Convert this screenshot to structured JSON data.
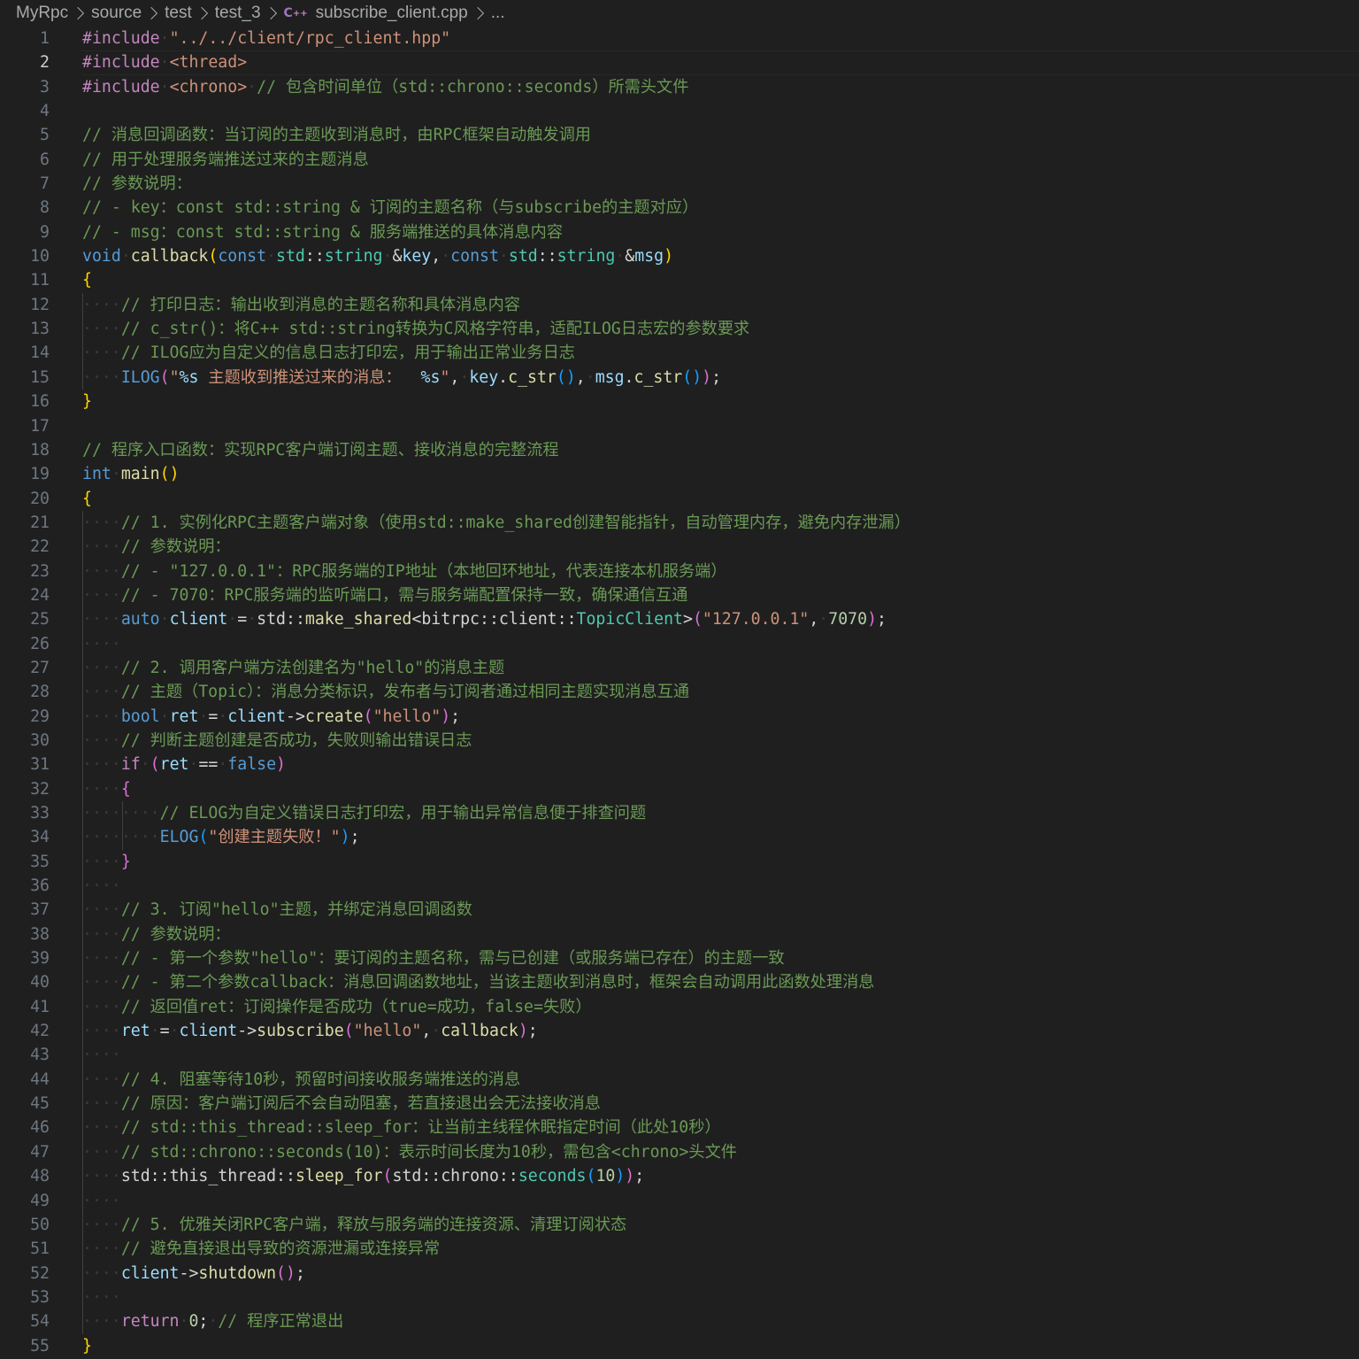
{
  "breadcrumb": {
    "items": [
      "MyRpc",
      "source",
      "test",
      "test_3"
    ],
    "file_icon": "cpp-file-icon",
    "file_icon_text": "C++",
    "file": "subscribe_client.cpp",
    "more": "..."
  },
  "editor": {
    "language": "cpp",
    "current_line": 2,
    "theme_colors": {
      "background": "#1f1f1f",
      "keyword": "#569cd6",
      "control": "#c586c0",
      "string": "#ce9178",
      "function": "#dcdcaa",
      "variable": "#9cdcfe",
      "type": "#4ec9b0",
      "number": "#b5cea8",
      "comment": "#6a9955",
      "line_number": "#6e7681"
    },
    "lines": [
      {
        "n": "1",
        "indent": 0,
        "t": [
          [
            "pp",
            "#include"
          ],
          [
            "ws",
            "·"
          ],
          [
            "str",
            "\"../../client/rpc_client.hpp\""
          ]
        ]
      },
      {
        "n": "2",
        "indent": 0,
        "t": [
          [
            "pp",
            "#include"
          ],
          [
            "ws",
            "·"
          ],
          [
            "str",
            "<thread>"
          ]
        ]
      },
      {
        "n": "3",
        "indent": 0,
        "t": [
          [
            "pp",
            "#include"
          ],
          [
            "ws",
            "·"
          ],
          [
            "str",
            "<chrono>"
          ],
          [
            "ws",
            "·"
          ],
          [
            "cmt",
            "// 包含时间单位（std::chrono::seconds）所需头文件"
          ]
        ]
      },
      {
        "n": "4",
        "indent": 0,
        "t": []
      },
      {
        "n": "5",
        "indent": 0,
        "t": [
          [
            "cmt",
            "// 消息回调函数：当订阅的主题收到消息时，由RPC框架自动触发调用"
          ]
        ]
      },
      {
        "n": "6",
        "indent": 0,
        "t": [
          [
            "cmt",
            "// 用于处理服务端推送过来的主题消息"
          ]
        ]
      },
      {
        "n": "7",
        "indent": 0,
        "t": [
          [
            "cmt",
            "// 参数说明："
          ]
        ]
      },
      {
        "n": "8",
        "indent": 0,
        "t": [
          [
            "cmt",
            "// - key：const std::string & 订阅的主题名称（与subscribe的主题对应）"
          ]
        ]
      },
      {
        "n": "9",
        "indent": 0,
        "t": [
          [
            "cmt",
            "// - msg：const std::string & 服务端推送的具体消息内容"
          ]
        ]
      },
      {
        "n": "10",
        "indent": 0,
        "t": [
          [
            "kw",
            "void"
          ],
          [
            "ws",
            "·"
          ],
          [
            "fn",
            "callback"
          ],
          [
            "b1",
            "("
          ],
          [
            "kw",
            "const"
          ],
          [
            "ws",
            "·"
          ],
          [
            "type",
            "std"
          ],
          [
            "op",
            "::"
          ],
          [
            "type",
            "string"
          ],
          [
            "ws",
            "·"
          ],
          [
            "op",
            "&"
          ],
          [
            "var",
            "key"
          ],
          [
            "op",
            ","
          ],
          [
            "ws",
            "·"
          ],
          [
            "kw",
            "const"
          ],
          [
            "ws",
            "·"
          ],
          [
            "type",
            "std"
          ],
          [
            "op",
            "::"
          ],
          [
            "type",
            "string"
          ],
          [
            "ws",
            "·"
          ],
          [
            "op",
            "&"
          ],
          [
            "var",
            "msg"
          ],
          [
            "b1",
            ")"
          ]
        ]
      },
      {
        "n": "11",
        "indent": 0,
        "t": [
          [
            "b1",
            "{"
          ]
        ]
      },
      {
        "n": "12",
        "indent": 1,
        "t": [
          [
            "cmt",
            "// 打印日志：输出收到消息的主题名称和具体消息内容"
          ]
        ]
      },
      {
        "n": "13",
        "indent": 1,
        "t": [
          [
            "cmt",
            "// c_str()：将C++ std::string转换为C风格字符串，适配ILOG日志宏的参数要求"
          ]
        ]
      },
      {
        "n": "14",
        "indent": 1,
        "t": [
          [
            "cmt",
            "// ILOG应为自定义的信息日志打印宏，用于输出正常业务日志"
          ]
        ]
      },
      {
        "n": "15",
        "indent": 1,
        "t": [
          [
            "mac",
            "ILOG"
          ],
          [
            "b2",
            "("
          ],
          [
            "str",
            "\""
          ],
          [
            "esc",
            "%s"
          ],
          [
            "str",
            " 主题收到推送过来的消息：  "
          ],
          [
            "esc",
            "%s"
          ],
          [
            "str",
            "\""
          ],
          [
            "op",
            ","
          ],
          [
            "ws",
            "·"
          ],
          [
            "var",
            "key"
          ],
          [
            "op",
            "."
          ],
          [
            "fn",
            "c_str"
          ],
          [
            "b3",
            "()"
          ],
          [
            "op",
            ","
          ],
          [
            "ws",
            "·"
          ],
          [
            "var",
            "msg"
          ],
          [
            "op",
            "."
          ],
          [
            "fn",
            "c_str"
          ],
          [
            "b3",
            "()"
          ],
          [
            "b2",
            ")"
          ],
          [
            "op",
            ";"
          ]
        ]
      },
      {
        "n": "16",
        "indent": 0,
        "t": [
          [
            "b1",
            "}"
          ]
        ]
      },
      {
        "n": "17",
        "indent": 0,
        "t": []
      },
      {
        "n": "18",
        "indent": 0,
        "t": [
          [
            "cmt",
            "// 程序入口函数：实现RPC客户端订阅主题、接收消息的完整流程"
          ]
        ]
      },
      {
        "n": "19",
        "indent": 0,
        "t": [
          [
            "kw",
            "int"
          ],
          [
            "ws",
            "·"
          ],
          [
            "fn",
            "main"
          ],
          [
            "b1",
            "()"
          ]
        ]
      },
      {
        "n": "20",
        "indent": 0,
        "t": [
          [
            "b1",
            "{"
          ]
        ]
      },
      {
        "n": "21",
        "indent": 1,
        "t": [
          [
            "cmt",
            "// 1. 实例化RPC主题客户端对象（使用std::make_shared创建智能指针，自动管理内存，避免内存泄漏）"
          ]
        ]
      },
      {
        "n": "22",
        "indent": 1,
        "t": [
          [
            "cmt",
            "// 参数说明："
          ]
        ]
      },
      {
        "n": "23",
        "indent": 1,
        "t": [
          [
            "cmt",
            "// - \"127.0.0.1\"：RPC服务端的IP地址（本地回环地址，代表连接本机服务端）"
          ]
        ]
      },
      {
        "n": "24",
        "indent": 1,
        "t": [
          [
            "cmt",
            "// - 7070：RPC服务端的监听端口，需与服务端配置保持一致，确保通信互通"
          ]
        ]
      },
      {
        "n": "25",
        "indent": 1,
        "t": [
          [
            "kw",
            "auto"
          ],
          [
            "ws",
            "·"
          ],
          [
            "var",
            "client"
          ],
          [
            "ws",
            "·"
          ],
          [
            "op",
            "="
          ],
          [
            "ws",
            "·"
          ],
          [
            "txt",
            "std"
          ],
          [
            "op",
            "::"
          ],
          [
            "fn",
            "make_shared"
          ],
          [
            "op",
            "<"
          ],
          [
            "txt",
            "bitrpc"
          ],
          [
            "op",
            "::"
          ],
          [
            "txt",
            "client"
          ],
          [
            "op",
            "::"
          ],
          [
            "type",
            "TopicClient"
          ],
          [
            "op",
            ">"
          ],
          [
            "b2",
            "("
          ],
          [
            "str",
            "\"127.0.0.1\""
          ],
          [
            "op",
            ","
          ],
          [
            "ws",
            "·"
          ],
          [
            "num",
            "7070"
          ],
          [
            "b2",
            ")"
          ],
          [
            "op",
            ";"
          ]
        ]
      },
      {
        "n": "26",
        "indent": 1,
        "t": []
      },
      {
        "n": "27",
        "indent": 1,
        "t": [
          [
            "cmt",
            "// 2. 调用客户端方法创建名为\"hello\"的消息主题"
          ]
        ]
      },
      {
        "n": "28",
        "indent": 1,
        "t": [
          [
            "cmt",
            "// 主题（Topic）：消息分类标识，发布者与订阅者通过相同主题实现消息互通"
          ]
        ]
      },
      {
        "n": "29",
        "indent": 1,
        "t": [
          [
            "kw",
            "bool"
          ],
          [
            "ws",
            "·"
          ],
          [
            "var",
            "ret"
          ],
          [
            "ws",
            "·"
          ],
          [
            "op",
            "="
          ],
          [
            "ws",
            "·"
          ],
          [
            "var",
            "client"
          ],
          [
            "op",
            "->"
          ],
          [
            "fn",
            "create"
          ],
          [
            "b2",
            "("
          ],
          [
            "str",
            "\"hello\""
          ],
          [
            "b2",
            ")"
          ],
          [
            "op",
            ";"
          ]
        ]
      },
      {
        "n": "30",
        "indent": 1,
        "t": [
          [
            "cmt",
            "// 判断主题创建是否成功，失败则输出错误日志"
          ]
        ]
      },
      {
        "n": "31",
        "indent": 1,
        "t": [
          [
            "ctrl",
            "if"
          ],
          [
            "ws",
            "·"
          ],
          [
            "b2",
            "("
          ],
          [
            "var",
            "ret"
          ],
          [
            "ws",
            "·"
          ],
          [
            "op",
            "=="
          ],
          [
            "ws",
            "·"
          ],
          [
            "kw",
            "false"
          ],
          [
            "b2",
            ")"
          ]
        ]
      },
      {
        "n": "32",
        "indent": 1,
        "t": [
          [
            "b2",
            "{"
          ]
        ]
      },
      {
        "n": "33",
        "indent": 2,
        "t": [
          [
            "cmt",
            "// ELOG为自定义错误日志打印宏，用于输出异常信息便于排查问题"
          ]
        ]
      },
      {
        "n": "34",
        "indent": 2,
        "t": [
          [
            "mac",
            "ELOG"
          ],
          [
            "b3",
            "("
          ],
          [
            "str",
            "\"创建主题失败！\""
          ],
          [
            "b3",
            ")"
          ],
          [
            "op",
            ";"
          ]
        ]
      },
      {
        "n": "35",
        "indent": 1,
        "t": [
          [
            "b2",
            "}"
          ]
        ]
      },
      {
        "n": "36",
        "indent": 1,
        "t": []
      },
      {
        "n": "37",
        "indent": 1,
        "t": [
          [
            "cmt",
            "// 3. 订阅\"hello\"主题，并绑定消息回调函数"
          ]
        ]
      },
      {
        "n": "38",
        "indent": 1,
        "t": [
          [
            "cmt",
            "// 参数说明："
          ]
        ]
      },
      {
        "n": "39",
        "indent": 1,
        "t": [
          [
            "cmt",
            "// - 第一个参数\"hello\"：要订阅的主题名称，需与已创建（或服务端已存在）的主题一致"
          ]
        ]
      },
      {
        "n": "40",
        "indent": 1,
        "t": [
          [
            "cmt",
            "// - 第二个参数callback：消息回调函数地址，当该主题收到消息时，框架会自动调用此函数处理消息"
          ]
        ]
      },
      {
        "n": "41",
        "indent": 1,
        "t": [
          [
            "cmt",
            "// 返回值ret：订阅操作是否成功（true=成功，false=失败）"
          ]
        ]
      },
      {
        "n": "42",
        "indent": 1,
        "t": [
          [
            "var",
            "ret"
          ],
          [
            "ws",
            "·"
          ],
          [
            "op",
            "="
          ],
          [
            "ws",
            "·"
          ],
          [
            "var",
            "client"
          ],
          [
            "op",
            "->"
          ],
          [
            "fn",
            "subscribe"
          ],
          [
            "b2",
            "("
          ],
          [
            "str",
            "\"hello\""
          ],
          [
            "op",
            ","
          ],
          [
            "ws",
            "·"
          ],
          [
            "fn",
            "callback"
          ],
          [
            "b2",
            ")"
          ],
          [
            "op",
            ";"
          ]
        ]
      },
      {
        "n": "43",
        "indent": 1,
        "t": []
      },
      {
        "n": "44",
        "indent": 1,
        "t": [
          [
            "cmt",
            "// 4. 阻塞等待10秒，预留时间接收服务端推送的消息"
          ]
        ]
      },
      {
        "n": "45",
        "indent": 1,
        "t": [
          [
            "cmt",
            "// 原因：客户端订阅后不会自动阻塞，若直接退出会无法接收消息"
          ]
        ]
      },
      {
        "n": "46",
        "indent": 1,
        "t": [
          [
            "cmt",
            "// std::this_thread::sleep_for：让当前主线程休眠指定时间（此处10秒）"
          ]
        ]
      },
      {
        "n": "47",
        "indent": 1,
        "t": [
          [
            "cmt",
            "// std::chrono::seconds(10)：表示时间长度为10秒，需包含<chrono>头文件"
          ]
        ]
      },
      {
        "n": "48",
        "indent": 1,
        "t": [
          [
            "txt",
            "std"
          ],
          [
            "op",
            "::"
          ],
          [
            "txt",
            "this_thread"
          ],
          [
            "op",
            "::"
          ],
          [
            "fn",
            "sleep_for"
          ],
          [
            "b2",
            "("
          ],
          [
            "txt",
            "std"
          ],
          [
            "op",
            "::"
          ],
          [
            "txt",
            "chrono"
          ],
          [
            "op",
            "::"
          ],
          [
            "type",
            "seconds"
          ],
          [
            "b3",
            "("
          ],
          [
            "num",
            "10"
          ],
          [
            "b3",
            ")"
          ],
          [
            "b2",
            ")"
          ],
          [
            "op",
            ";"
          ]
        ]
      },
      {
        "n": "49",
        "indent": 1,
        "t": []
      },
      {
        "n": "50",
        "indent": 1,
        "t": [
          [
            "cmt",
            "// 5. 优雅关闭RPC客户端，释放与服务端的连接资源、清理订阅状态"
          ]
        ]
      },
      {
        "n": "51",
        "indent": 1,
        "t": [
          [
            "cmt",
            "// 避免直接退出导致的资源泄漏或连接异常"
          ]
        ]
      },
      {
        "n": "52",
        "indent": 1,
        "t": [
          [
            "var",
            "client"
          ],
          [
            "op",
            "->"
          ],
          [
            "fn",
            "shutdown"
          ],
          [
            "b2",
            "()"
          ],
          [
            "op",
            ";"
          ]
        ]
      },
      {
        "n": "53",
        "indent": 1,
        "t": []
      },
      {
        "n": "54",
        "indent": 1,
        "t": [
          [
            "ctrl",
            "return"
          ],
          [
            "ws",
            "·"
          ],
          [
            "num",
            "0"
          ],
          [
            "op",
            ";"
          ],
          [
            "ws",
            "·"
          ],
          [
            "cmt",
            "// 程序正常退出"
          ]
        ]
      },
      {
        "n": "55",
        "indent": 0,
        "t": [
          [
            "b1",
            "}"
          ]
        ]
      }
    ]
  }
}
